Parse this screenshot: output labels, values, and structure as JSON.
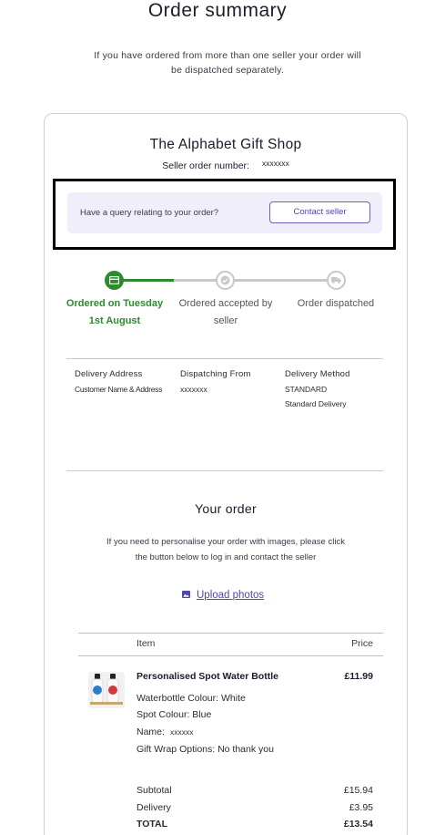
{
  "page": {
    "title": "Order summary",
    "intro": "If you have ordered from more than one seller your order will be dispatched separately."
  },
  "seller": {
    "shop_name": "The Alphabet Gift Shop",
    "order_number_label": "Seller order number:",
    "order_number_value": "xxxxxxx"
  },
  "query": {
    "text": "Have a query relating to your order?",
    "button_label": "Contact seller"
  },
  "progress": {
    "steps": [
      {
        "label": "Ordered on Tuesday 1st August",
        "state": "complete",
        "icon": "card-icon"
      },
      {
        "label": "Ordered accepted by seller",
        "state": "pending",
        "icon": "check-circle-icon"
      },
      {
        "label": "Order dispatched",
        "state": "pending",
        "icon": "truck-icon"
      }
    ],
    "complete_color": "#2d8a2d",
    "pending_color": "#c8c8c8"
  },
  "delivery": {
    "address_heading": "Delivery Address",
    "address_value": "Customer Name & Address",
    "dispatch_heading": "Dispatching From",
    "dispatch_value": "xxxxxxx",
    "method_heading": "Delivery Method",
    "method_code": "STANDARD",
    "method_name": "Standard Delivery"
  },
  "your_order": {
    "heading": "Your order",
    "personalise_text": "If you need to personalise your order with images, please click the button below to log in and contact the seller",
    "upload_label": "Upload photos"
  },
  "table": {
    "col_item": "Item",
    "col_price": "Price"
  },
  "product": {
    "name": "Personalised Spot Water Bottle",
    "price": "£11.99",
    "options": [
      "Waterbottle Colour: White",
      "Spot Colour: Blue",
      "Gift Wrap Options: No thank you"
    ],
    "name_option_label": "Name:",
    "name_option_value": "xxxxxx"
  },
  "totals": {
    "subtotal_label": "Subtotal",
    "subtotal_value": "£15.94",
    "delivery_label": "Delivery",
    "delivery_value": "£3.95",
    "total_label": "TOTAL",
    "total_value": "£13.54"
  },
  "colors": {
    "accent": "#4e48a8",
    "query_panel_bg": "#efeefa"
  }
}
